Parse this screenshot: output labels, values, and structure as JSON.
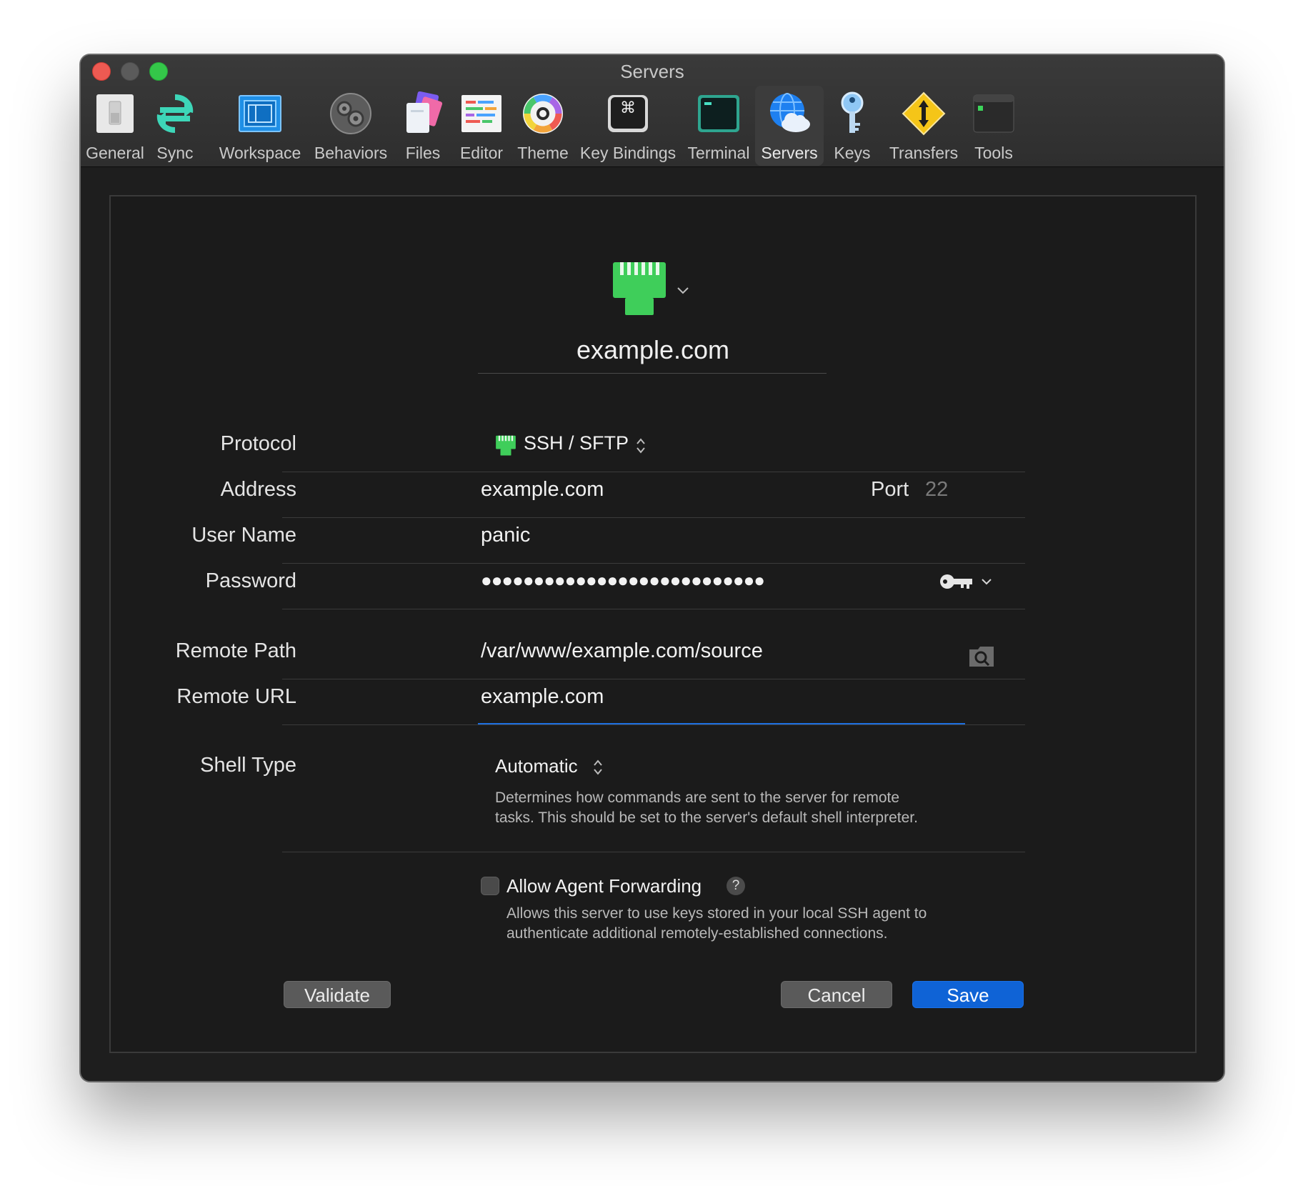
{
  "window": {
    "title": "Servers"
  },
  "toolbar": {
    "items": [
      {
        "label": "General"
      },
      {
        "label": "Sync"
      },
      {
        "label": "Workspace"
      },
      {
        "label": "Behaviors"
      },
      {
        "label": "Files"
      },
      {
        "label": "Editor"
      },
      {
        "label": "Theme"
      },
      {
        "label": "Key Bindings"
      },
      {
        "label": "Terminal"
      },
      {
        "label": "Servers",
        "active": true
      },
      {
        "label": "Keys"
      },
      {
        "label": "Transfers"
      },
      {
        "label": "Tools"
      }
    ],
    "key_symbol": "⌘"
  },
  "server": {
    "name": "example.com",
    "icon": "ethernet-plug-icon",
    "icon_color": "#3fce5a"
  },
  "form": {
    "protocol_label": "Protocol",
    "protocol_value": "SSH / SFTP",
    "address_label": "Address",
    "address_value": "example.com",
    "port_label": "Port",
    "port_placeholder": "22",
    "username_label": "User Name",
    "username_value": "panic",
    "password_label": "Password",
    "password_value": "●●●●●●●●●●●●●●●●●●●●●●●●●●●",
    "remote_path_label": "Remote Path",
    "remote_path_value": "/var/www/example.com/source",
    "remote_url_label": "Remote URL",
    "remote_url_value": "example.com",
    "shell_type_label": "Shell Type",
    "shell_type_value": "Automatic",
    "shell_type_hint_1": "Determines how commands are sent to the server for remote",
    "shell_type_hint_2": "tasks. This should be set to the server's default shell interpreter.",
    "agent_forwarding_label": "Allow Agent Forwarding",
    "agent_forwarding_checked": false,
    "agent_forwarding_hint_1": "Allows this server to use keys stored in your local SSH agent to",
    "agent_forwarding_hint_2": "authenticate additional remotely-established connections.",
    "help_glyph": "?"
  },
  "buttons": {
    "validate": "Validate",
    "cancel": "Cancel",
    "save": "Save"
  },
  "colors": {
    "accent": "#0f63d6",
    "focus_underline": "#1e6fe0"
  }
}
